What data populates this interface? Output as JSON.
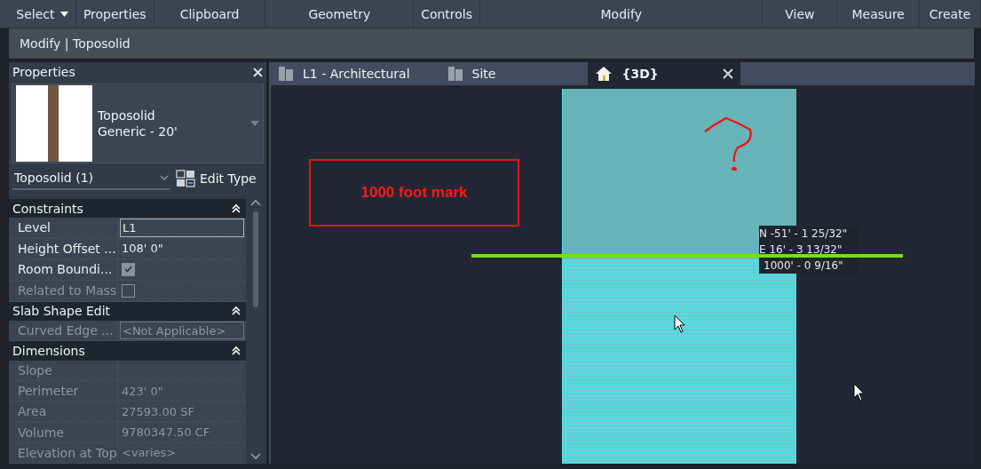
{
  "ribbon": {
    "tabs": [
      {
        "label": "Select",
        "dropdown": true
      },
      {
        "label": "Properties",
        "dropdown": false
      },
      {
        "label": "Clipboard",
        "dropdown": false
      },
      {
        "label": "Geometry",
        "dropdown": false
      },
      {
        "label": "Controls",
        "dropdown": false
      },
      {
        "label": "Modify",
        "dropdown": false
      },
      {
        "label": "View",
        "dropdown": false
      },
      {
        "label": "Measure",
        "dropdown": false
      },
      {
        "label": "Create",
        "dropdown": false
      }
    ]
  },
  "context_bar": {
    "title": "Modify | Toposolid"
  },
  "properties": {
    "title": "Properties",
    "type": {
      "family": "Toposolid",
      "name": "Generic - 20'"
    },
    "instance_selector": "Toposolid (1)",
    "edit_type": "Edit Type",
    "groups": [
      {
        "title": "Constraints",
        "expanded": true,
        "rows": [
          {
            "label": "Level",
            "kind": "field",
            "value": "L1",
            "disabled": false
          },
          {
            "label": "Height Offset ...",
            "kind": "text",
            "value": "108'  0\"",
            "disabled": false
          },
          {
            "label": "Room Boundi...",
            "kind": "checkbox",
            "checked": true,
            "disabled": false
          },
          {
            "label": "Related to Mass",
            "kind": "checkbox",
            "checked": false,
            "disabled": true
          }
        ]
      },
      {
        "title": "Slab Shape Edit",
        "expanded": true,
        "rows": [
          {
            "label": "Curved Edge ...",
            "kind": "field",
            "value": "<Not Applicable>",
            "disabled": true
          }
        ]
      },
      {
        "title": "Dimensions",
        "expanded": true,
        "rows": [
          {
            "label": "Slope",
            "kind": "text",
            "disabled": true
          },
          {
            "label": "Perimeter",
            "kind": "text",
            "value": "423'  0\"",
            "disabled": true
          },
          {
            "label": "Area",
            "kind": "text",
            "value": "27593.00 SF",
            "disabled": true
          },
          {
            "label": "Volume",
            "kind": "text",
            "value": "9780347.50 CF",
            "disabled": true
          },
          {
            "label": "Elevation at Top",
            "kind": "text",
            "value": "<varies>",
            "disabled": true
          }
        ]
      }
    ]
  },
  "view_tabs": [
    {
      "label": "L1 - Architectural",
      "kind": "plan",
      "selected": false
    },
    {
      "label": "Site",
      "kind": "plan",
      "selected": false
    },
    {
      "label": "{3D}",
      "kind": "perspective",
      "selected": true
    }
  ],
  "viewport": {
    "annotation": "1000 foot mark",
    "tooltip": [
      "N -51' - 1 25/32\"",
      "E 16' - 3 13/32\"",
      "1000' - 0 9/16\""
    ]
  }
}
